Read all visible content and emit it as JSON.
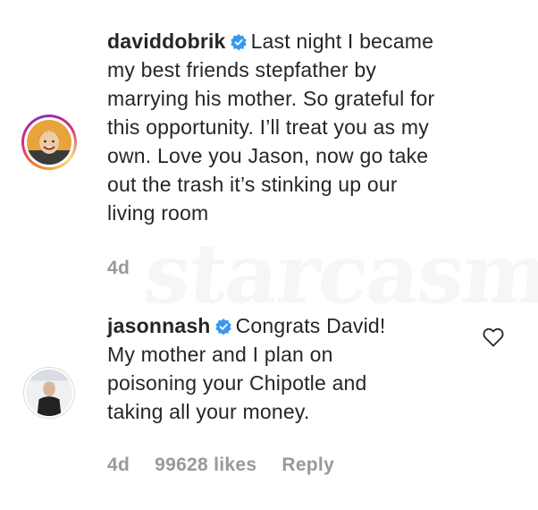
{
  "comments": [
    {
      "username": "daviddobrik",
      "verified": true,
      "lines": [
        "Last night I became",
        "my best friends stepfather by",
        "marrying his mother. So grateful for",
        "this opportunity. I’ll treat you as my",
        "own. Love you Jason, now go take",
        "out the trash it’s stinking up our",
        "living room"
      ],
      "time": "4d",
      "avatar_ring_colors": [
        "#f58529",
        "#dd2a7b",
        "#8134af",
        "#feda77"
      ]
    },
    {
      "username": "jasonnash",
      "verified": true,
      "lines": [
        "Congrats David!",
        "My mother and I plan on",
        "poisoning your Chipotle and",
        "taking all your money."
      ],
      "time": "4d",
      "likes": "99628 likes",
      "reply_label": "Reply"
    }
  ],
  "watermark": "starcasm",
  "icons": {
    "verified": "verified-badge-icon",
    "like": "heart-outline-icon"
  },
  "colors": {
    "verified_blue": "#3897f0",
    "meta_gray": "#999999",
    "text": "#262626"
  }
}
